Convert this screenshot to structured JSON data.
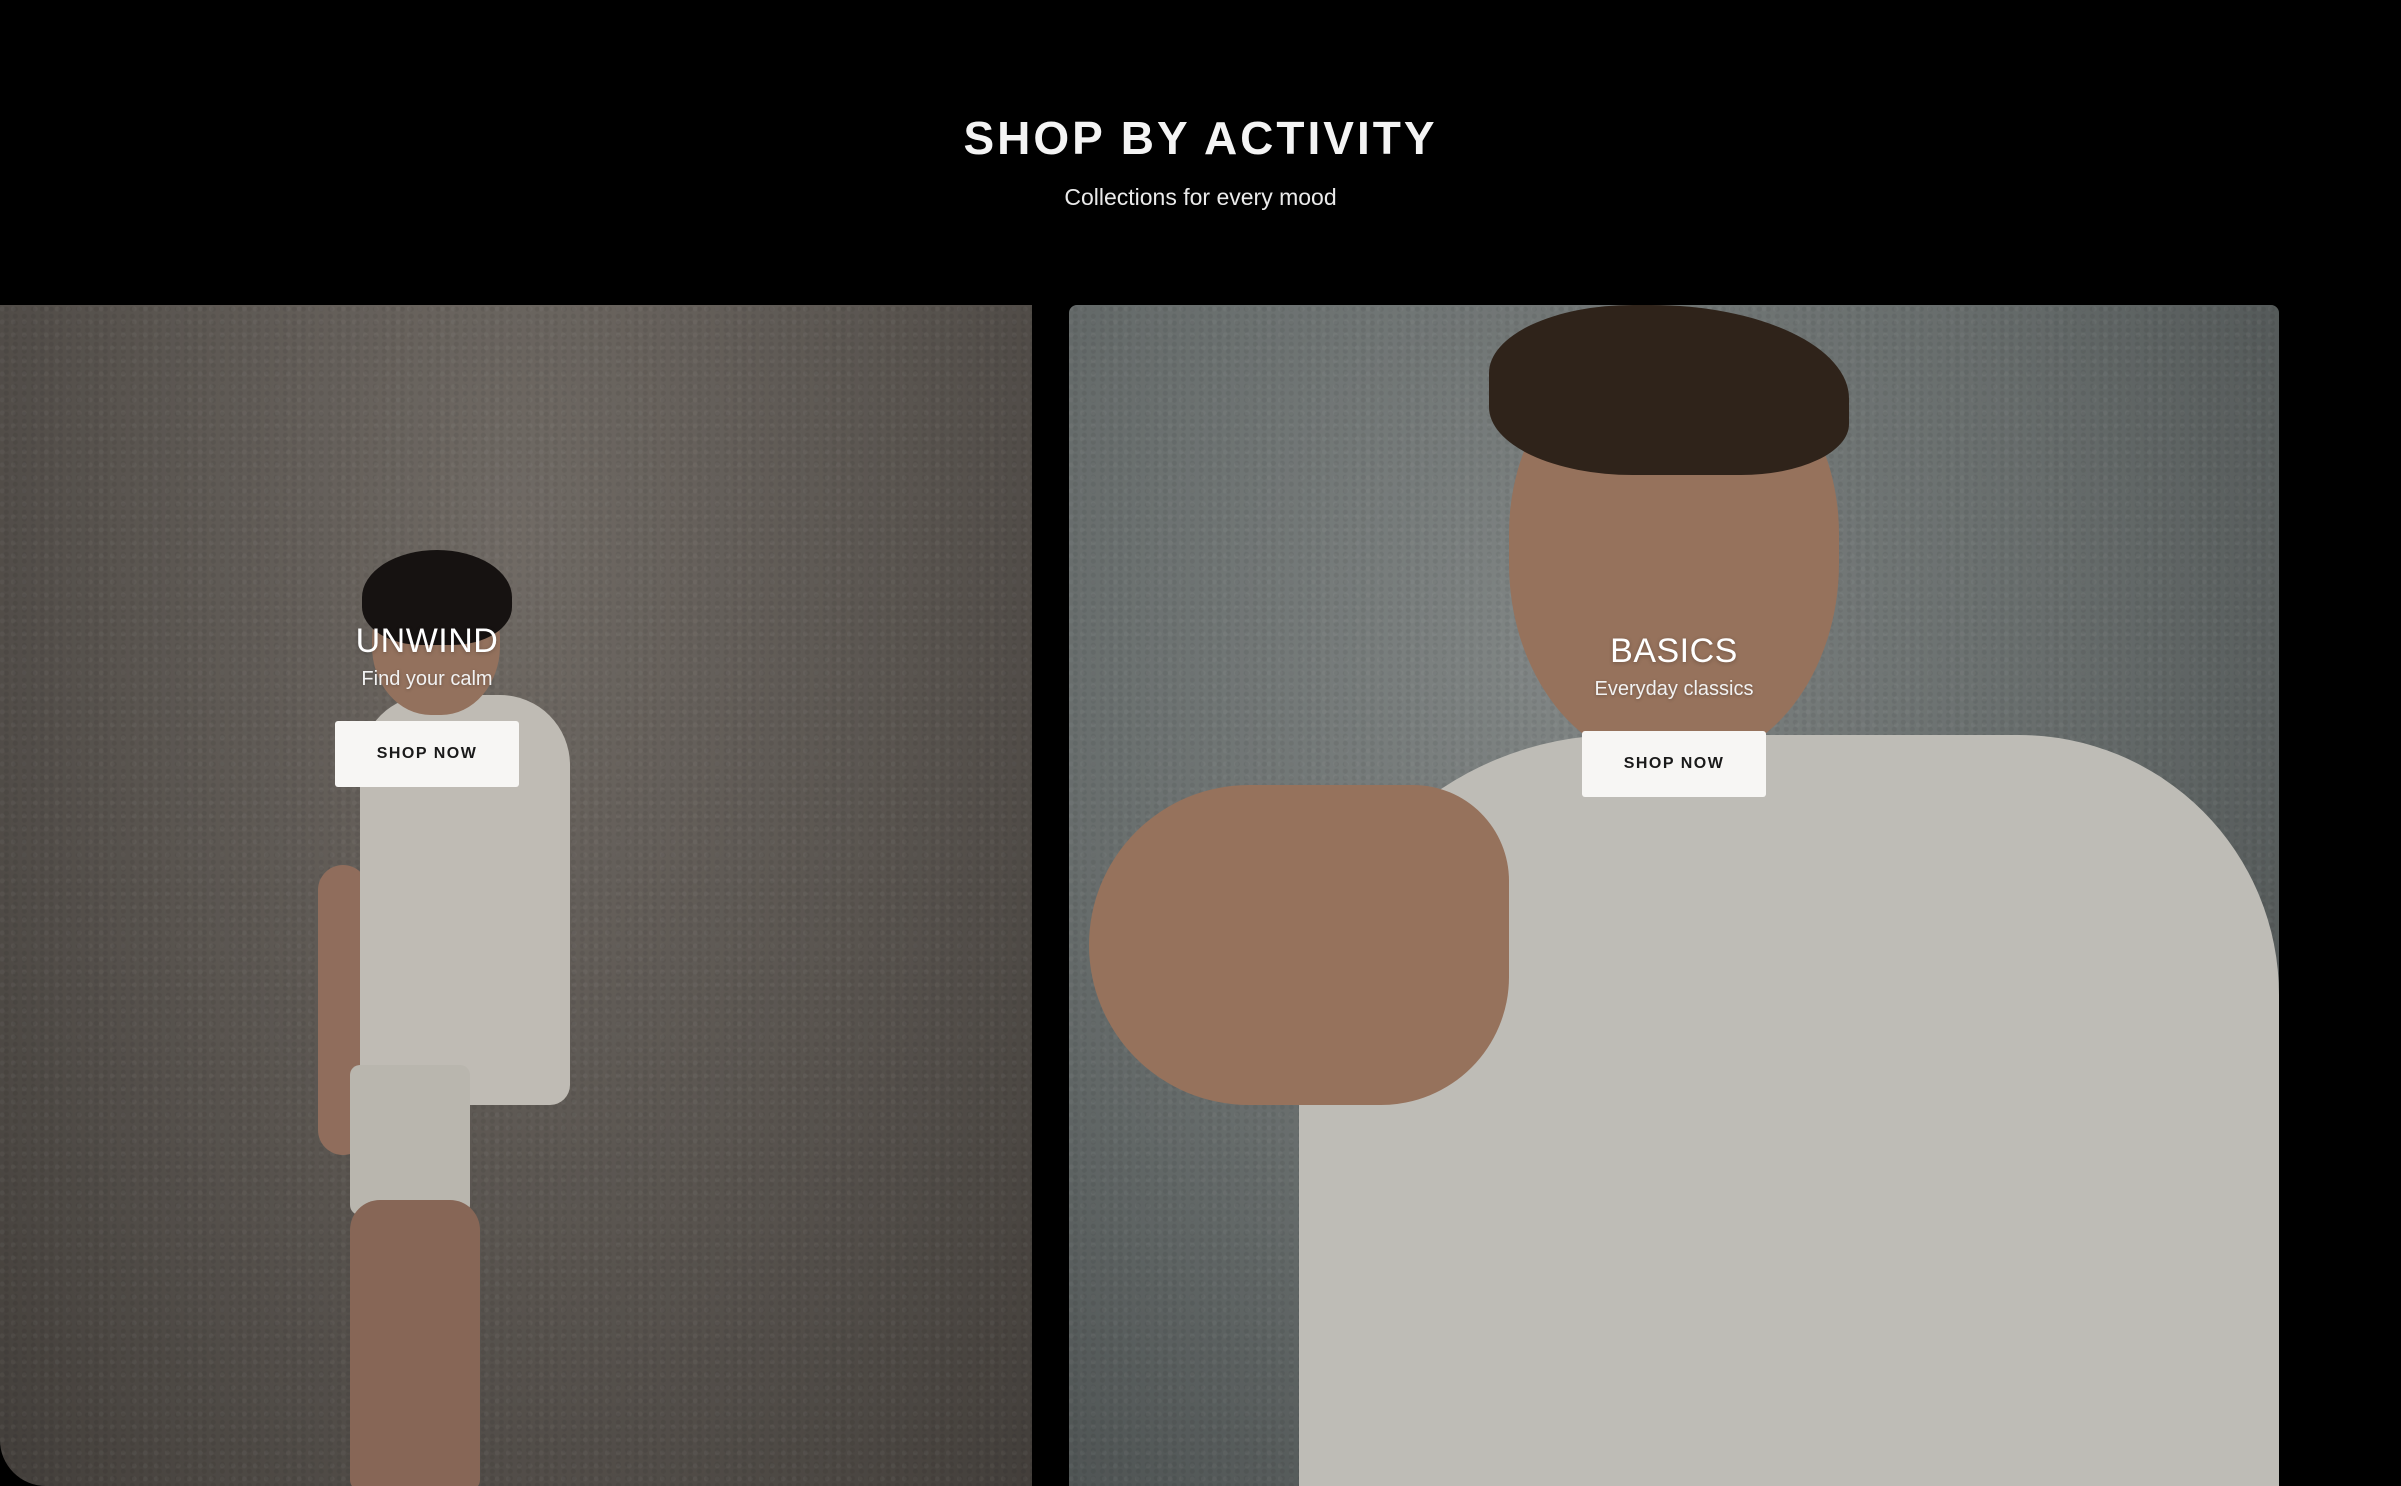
{
  "section": {
    "title": "SHOP BY ACTIVITY",
    "subtitle": "Collections for every mood"
  },
  "cards": [
    {
      "title": "UNWIND",
      "subtitle": "Find your calm",
      "button_label": "SHOP NOW"
    },
    {
      "title": "BASICS",
      "subtitle": "Everyday classics",
      "button_label": "SHOP NOW"
    }
  ],
  "colors": {
    "background": "#000000",
    "button_bg": "#f7f6f4",
    "button_text": "#1a1a1a",
    "text": "#ffffff"
  }
}
